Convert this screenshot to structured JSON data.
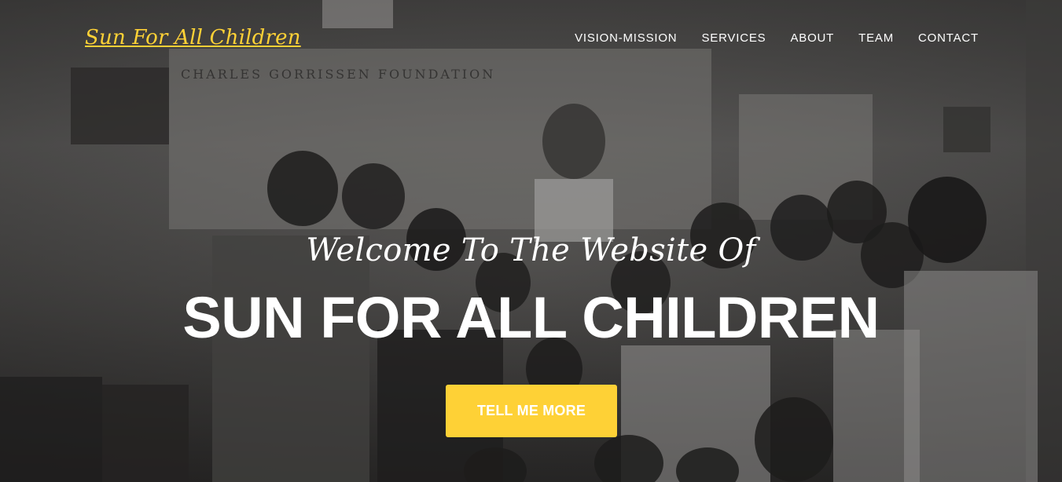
{
  "brand": {
    "name": "Sun For All Children",
    "color": "#fed136"
  },
  "nav": {
    "items": [
      {
        "label": "VISION-MISSION"
      },
      {
        "label": "SERVICES"
      },
      {
        "label": "ABOUT"
      },
      {
        "label": "TEAM"
      },
      {
        "label": "CONTACT"
      }
    ]
  },
  "hero": {
    "lead": "Welcome To The Website Of",
    "heading": "SUN FOR ALL CHILDREN",
    "cta_label": "TELL ME MORE",
    "accent": "#fed136",
    "photo_sign_text": "CHARLES GORRISSEN FOUNDATION"
  }
}
